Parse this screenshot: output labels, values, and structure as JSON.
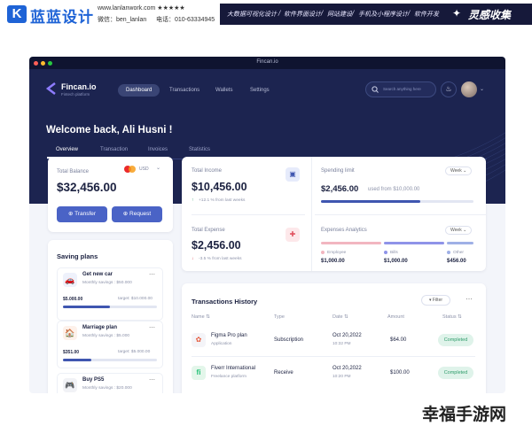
{
  "banner": {
    "logo_glyph": "K",
    "brand": "蓝蓝设计",
    "url": "www.lanlanwork.com ★★★★★",
    "contact_wechat": "微信：ben_lanlan",
    "contact_phone": "电话：010-63334945",
    "nav": [
      "大数据可视化设计",
      "/",
      "软件界面设计",
      "/",
      "网站建设",
      "/",
      "手机及小程序设计",
      "/",
      "软件开发"
    ],
    "right_brand": "灵感收集",
    "right_brand_icon": "star-logo-icon"
  },
  "window": {
    "title": "Fincan.io",
    "app": {
      "name": "Fincan.io",
      "tagline": "Fintech platform"
    },
    "nav_tabs": [
      "Dashboard",
      "Transactions",
      "Wallets",
      "Settings"
    ],
    "active_nav": "Dashboard",
    "search_placeholder": "Search anything here",
    "welcome": "Welcome back, Ali Husni !",
    "sub_tabs": [
      "Overview",
      "Transaction",
      "Invoices",
      "Statistics"
    ],
    "active_sub_tab": "Overview",
    "balance": {
      "label": "Total Balance",
      "currency": "USD",
      "amount": "$32,456.00",
      "transfer": "Transfer",
      "request": "Request"
    },
    "income": {
      "label": "Total Income",
      "amount": "$10,456.00",
      "delta": "+12.1 % from last weeks"
    },
    "expense": {
      "label": "Total Expense",
      "amount": "$2,456.00",
      "delta": "-3.5 % from last weeks"
    },
    "spending": {
      "label": "Spending limit",
      "period": "Week",
      "used": "$2,456.00",
      "of": "used from $10,000.00",
      "progress": 0.65
    },
    "analytics": {
      "label": "Expenses Analytics",
      "period": "Week",
      "items": [
        {
          "name": "Employee",
          "value": "$1,000.00",
          "color": "#f2b6c0"
        },
        {
          "name": "Bills",
          "value": "$1,000.00",
          "color": "#8f93e8"
        },
        {
          "name": "Other",
          "value": "$456.00",
          "color": "#9fb0e6"
        }
      ]
    },
    "savings": {
      "title": "Saving plans",
      "items": [
        {
          "name": "Get new car",
          "sub": "Monthly savings : $50.000",
          "saved": "$5.000.00",
          "target": "target: $10.000.00",
          "progress": 0.5,
          "icon": "car-icon"
        },
        {
          "name": "Marriage plan",
          "sub": "Monthly savings : $5.000",
          "saved": "$351.00",
          "target": "target: $5.000.00",
          "progress": 0.3,
          "icon": "home-icon"
        },
        {
          "name": "Buy PS5",
          "sub": "Monthly savings : $20.000",
          "saved": "",
          "target": "",
          "progress": 0,
          "icon": "gamepad-icon"
        }
      ]
    },
    "transactions": {
      "title": "Transactions History",
      "filter": "Filter",
      "headers": [
        "Name",
        "Type",
        "Date",
        "Amount",
        "Status"
      ],
      "rows": [
        {
          "name": "Figma Pro plan",
          "sub": "Application",
          "type": "Subscription",
          "date": "Oct 20,2022",
          "time": "10:32 PM",
          "amount": "$64.00",
          "status": "Completed",
          "icon": "figma-icon"
        },
        {
          "name": "Fiverr International",
          "sub": "Freelance platform",
          "type": "Receive",
          "date": "Oct 20,2022",
          "time": "10:20 PM",
          "amount": "$100.00",
          "status": "Completed",
          "icon": "fiverr-icon"
        }
      ]
    }
  },
  "watermark": "幸福手游网"
}
